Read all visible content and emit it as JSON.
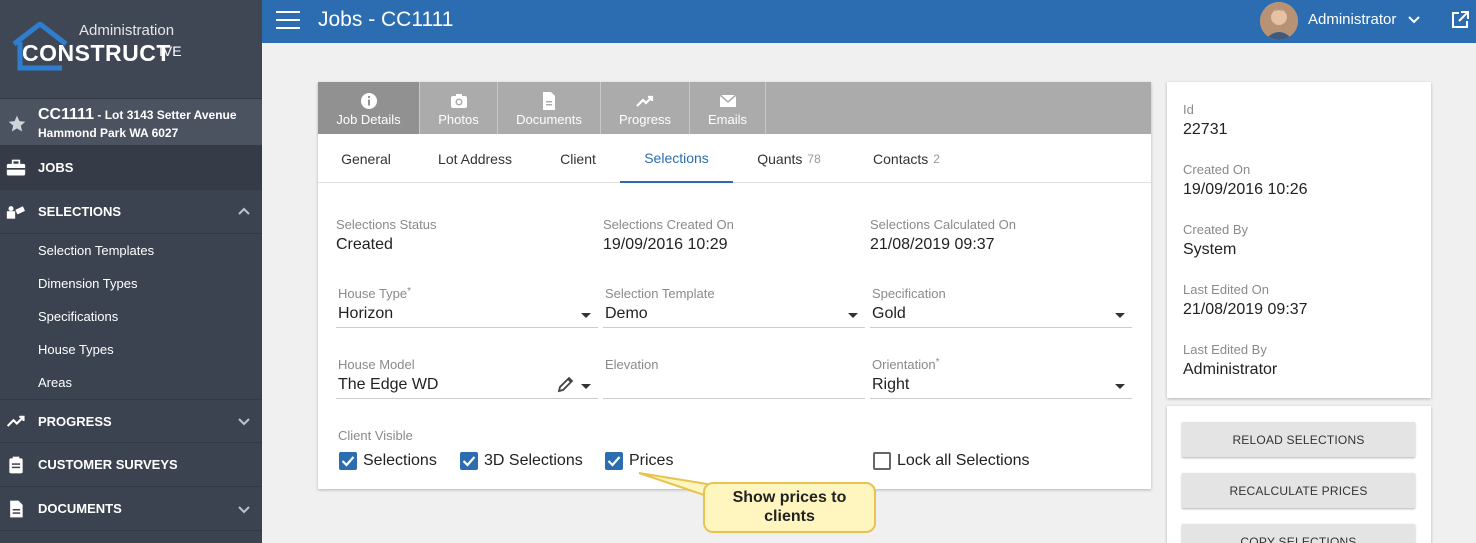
{
  "sidebar": {
    "admin_label": "Administration",
    "logo_text": "CONSTRUCT",
    "logo_suffix": "IVE",
    "current_job": {
      "code": "CC1111",
      "address_line1": " - Lot 3143 Setter Avenue",
      "address_line2": "Hammond Park WA 6027"
    },
    "nav": {
      "jobs": "JOBS",
      "selections": "SELECTIONS",
      "progress": "PROGRESS",
      "customer_surveys": "CUSTOMER SURVEYS",
      "documents": "DOCUMENTS"
    },
    "selections_sub": [
      "Selection Templates",
      "Dimension Types",
      "Specifications",
      "House Types",
      "Areas"
    ]
  },
  "header": {
    "title": "Jobs - CC1111",
    "user": "Administrator"
  },
  "tabs": [
    "Job Details",
    "Photos",
    "Documents",
    "Progress",
    "Emails"
  ],
  "subtabs": {
    "general": "General",
    "lot_address": "Lot Address",
    "client": "Client",
    "selections": "Selections",
    "quants": "Quants",
    "quants_count": "78",
    "contacts": "Contacts",
    "contacts_count": "2"
  },
  "form": {
    "status_label": "Selections Status",
    "status_value": "Created",
    "created_label": "Selections Created On",
    "created_value": "19/09/2016 10:29",
    "calculated_label": "Selections Calculated On",
    "calculated_value": "21/08/2019 09:37",
    "house_type_label": "House Type",
    "house_type_value": "Horizon",
    "template_label": "Selection Template",
    "template_value": "Demo",
    "spec_label": "Specification",
    "spec_value": "Gold",
    "model_label": "House Model",
    "model_value": "The Edge WD",
    "elevation_label": "Elevation",
    "elevation_value": "",
    "orientation_label": "Orientation",
    "orientation_value": "Right",
    "client_visible_label": "Client Visible",
    "cb_selections": "Selections",
    "cb_3d": "3D Selections",
    "cb_prices": "Prices",
    "cb_lock": "Lock all Selections",
    "required_mark": "*"
  },
  "info": {
    "id_label": "Id",
    "id_value": "22731",
    "created_on_label": "Created On",
    "created_on_value": "19/09/2016 10:26",
    "created_by_label": "Created By",
    "created_by_value": "System",
    "edited_on_label": "Last Edited On",
    "edited_on_value": "21/08/2019 09:37",
    "edited_by_label": "Last Edited By",
    "edited_by_value": "Administrator"
  },
  "actions": {
    "reload": "RELOAD SELECTIONS",
    "recalculate": "RECALCULATE PRICES",
    "copy": "COPY SELECTIONS"
  },
  "callout": {
    "line1": "Show prices to",
    "line2": "clients"
  },
  "colors": {
    "topbar": "#2b6db0",
    "sidebar": "#3c4350",
    "accent": "#2b6db0",
    "callout_bg": "#fff5bf"
  }
}
